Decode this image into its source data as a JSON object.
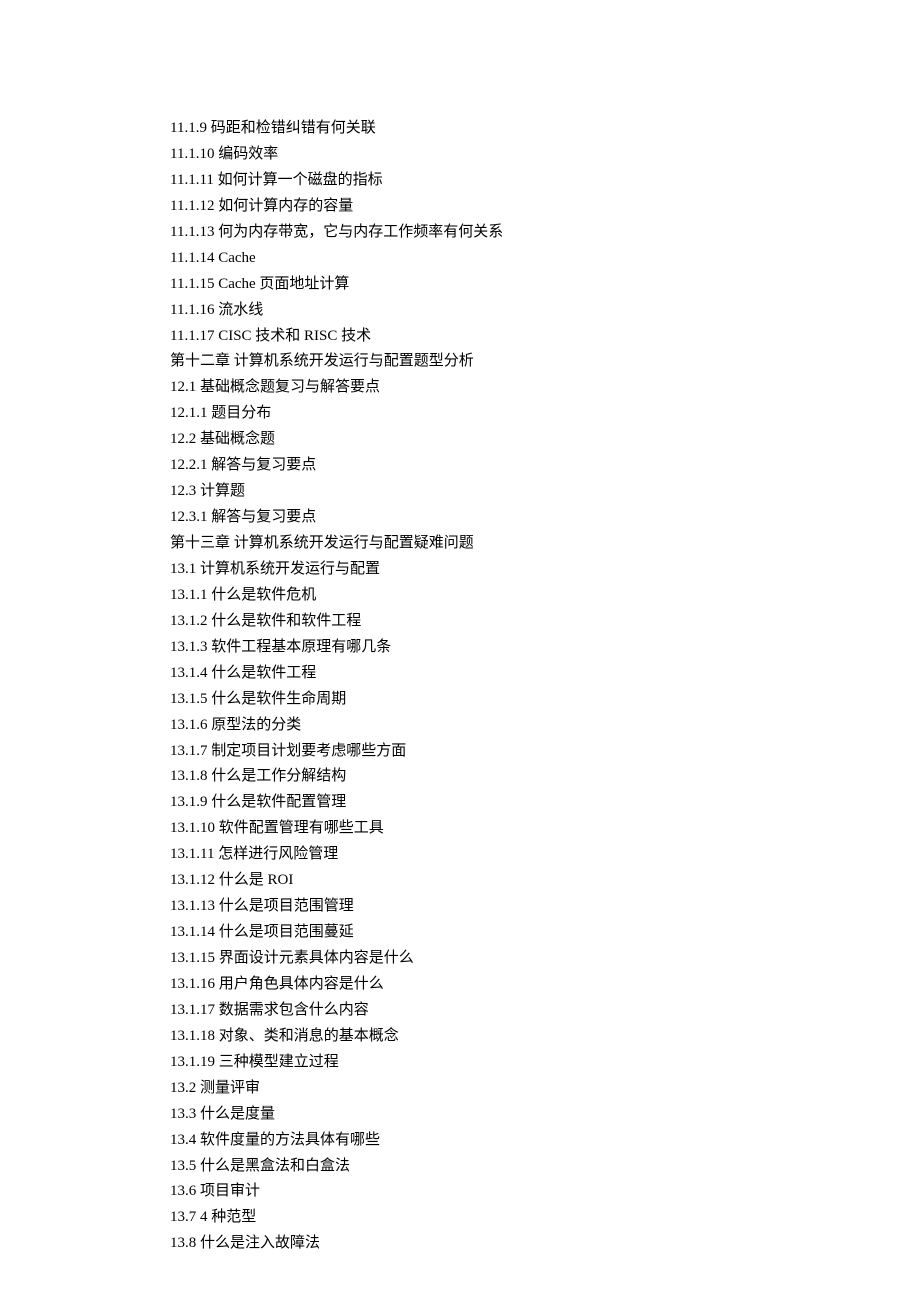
{
  "toc": {
    "items": [
      "11.1.9 码距和检错纠错有何关联",
      "11.1.10 编码效率",
      "11.1.11 如何计算一个磁盘的指标",
      "11.1.12 如何计算内存的容量",
      "11.1.13 何为内存带宽，它与内存工作频率有何关系",
      "11.1.14 Cache",
      "11.1.15 Cache 页面地址计算",
      "11.1.16 流水线",
      "11.1.17 CISC 技术和 RISC 技术",
      "第十二章 计算机系统开发运行与配置题型分析",
      "12.1 基础概念题复习与解答要点",
      "12.1.1 题目分布",
      "12.2 基础概念题",
      "12.2.1 解答与复习要点",
      "12.3 计算题",
      "12.3.1 解答与复习要点",
      "第十三章 计算机系统开发运行与配置疑难问题",
      "13.1 计算机系统开发运行与配置",
      "13.1.1 什么是软件危机",
      "13.1.2 什么是软件和软件工程",
      "13.1.3 软件工程基本原理有哪几条",
      "13.1.4 什么是软件工程",
      "13.1.5 什么是软件生命周期",
      "13.1.6 原型法的分类",
      "13.1.7 制定项目计划要考虑哪些方面",
      "13.1.8 什么是工作分解结构",
      "13.1.9 什么是软件配置管理",
      "13.1.10 软件配置管理有哪些工具",
      "13.1.11 怎样进行风险管理",
      "13.1.12 什么是 ROI",
      "13.1.13 什么是项目范围管理",
      "13.1.14 什么是项目范围蔓延",
      "13.1.15 界面设计元素具体内容是什么",
      "13.1.16 用户角色具体内容是什么",
      "13.1.17 数据需求包含什么内容",
      "13.1.18 对象、类和消息的基本概念",
      "13.1.19 三种模型建立过程",
      "13.2 测量评审",
      "13.3 什么是度量",
      "13.4 软件度量的方法具体有哪些",
      "13.5 什么是黑盒法和白盒法",
      "13.6 项目审计",
      "13.7 4 种范型",
      "13.8 什么是注入故障法"
    ]
  }
}
